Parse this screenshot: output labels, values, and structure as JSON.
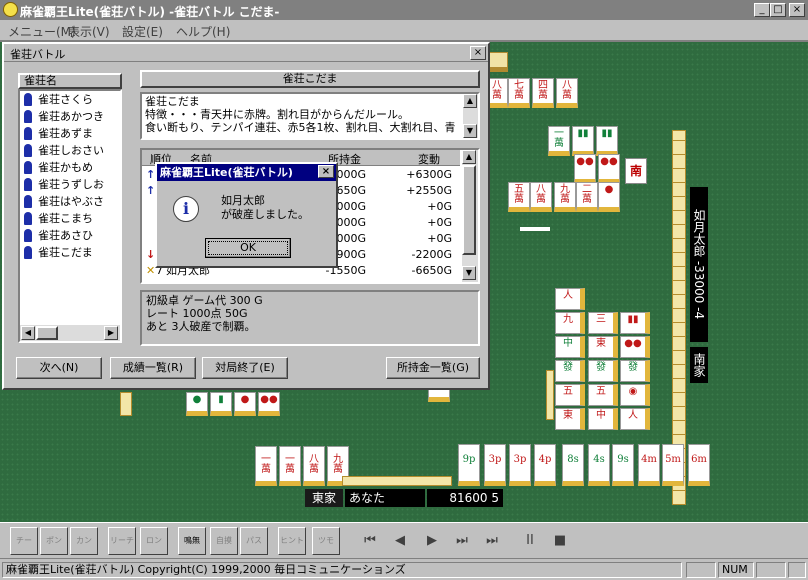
{
  "window": {
    "title": "麻雀覇王Lite(雀荘バトル) -雀荘バトル こだま-",
    "min_glyph": "_",
    "max_glyph": "□",
    "close_glyph": "×"
  },
  "menu": [
    "メニュー(M)",
    "表示(V)",
    "設定(E)",
    "ヘルプ(H)"
  ],
  "dialog": {
    "title": "雀荘バトル",
    "close_glyph": "×",
    "parlors_header": "雀荘名",
    "parlors": [
      "雀荘さくら",
      "雀荘あかつき",
      "雀荘あずま",
      "雀荘しおさい",
      "雀荘かもめ",
      "雀荘うずしお",
      "雀荘はやぶさ",
      "雀荘こまち",
      "雀荘あさひ",
      "雀荘こだま"
    ],
    "selected_name": "雀荘こだま",
    "description": [
      "雀荘こだま",
      "特徴・・・青天井に赤牌。割れ目がからんだルール。",
      "食い断もり、テンパイ連荘、赤5各1枚、割れ目、大割れ目、青"
    ],
    "table_headers": {
      "rank": "順位",
      "name": "名前",
      "money": "所持金",
      "change": "変動"
    },
    "rows": [
      {
        "rank": "",
        "name": "",
        "money": "000G",
        "change": "+6300G"
      },
      {
        "rank": "",
        "name": "",
        "money": "650G",
        "change": "+2550G"
      },
      {
        "rank": "",
        "name": "",
        "money": "000G",
        "change": "+0G"
      },
      {
        "rank": "",
        "name": "",
        "money": "000G",
        "change": "+0G"
      },
      {
        "rank": "",
        "name": "",
        "money": "000G",
        "change": "+0G"
      },
      {
        "rank": "",
        "name": "",
        "money": "900G",
        "change": "-2200G"
      },
      {
        "rank": "7",
        "name": "如月太郎",
        "money": "-1550G",
        "change": "-6650G"
      }
    ],
    "info": [
      "初級卓 ゲーム代 300 G",
      "レート 1000点 50G",
      "あと 3人破産で制覇。"
    ],
    "buttons": {
      "next": "次へ(N)",
      "results": "成績一覧(R)",
      "end": "対局終了(E)",
      "money": "所持金一覧(G)"
    }
  },
  "msgbox": {
    "title": "麻雀覇王Lite(雀荘バトル)",
    "close_glyph": "×",
    "icon_glyph": "i",
    "lines": [
      "如月太郎",
      "が破産しました。"
    ],
    "ok": "OK"
  },
  "game": {
    "player_wind": "東家",
    "player_name": "あなた",
    "player_score": "81600 5",
    "right_wind": "南家",
    "right_plate": "如月太郎 -33000 -4",
    "round_wind": "南",
    "hand": [
      "9p",
      "3p",
      "3p",
      "4p",
      "8s",
      "4s",
      "9s",
      "4m",
      "5m",
      "6m",
      "3m",
      "4m"
    ]
  },
  "toolbar": {
    "buttons": [
      "チー",
      "ポン",
      "カン",
      "リーチ",
      "ロン",
      "鳴無",
      "自摸",
      "パス",
      "ヒント",
      "ツモ"
    ],
    "play": [
      "⏮",
      "◀",
      "▶",
      "⏭",
      "⏭"
    ],
    "pause": "II",
    "stop": "■"
  },
  "status": {
    "left": "麻雀覇王Lite(雀荘バトル) Copyright(C) 1999,2000 毎日コミュニケーションズ",
    "num": "NUM"
  }
}
